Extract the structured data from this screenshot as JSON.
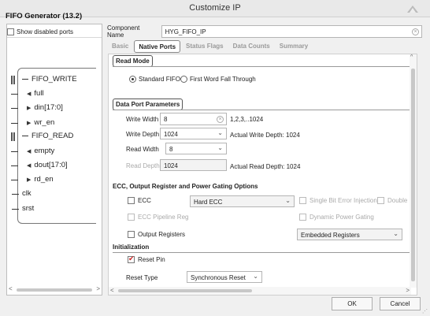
{
  "window": {
    "title": "Customize IP",
    "left_title": "FIFO Generator (13.2)"
  },
  "left": {
    "show_disabled_label": "Show disabled ports",
    "ports": [
      {
        "label": "FIFO_WRITE",
        "kind": "bus"
      },
      {
        "label": "full",
        "kind": "out"
      },
      {
        "label": "din[17:0]",
        "kind": "in"
      },
      {
        "label": "wr_en",
        "kind": "in"
      },
      {
        "label": "FIFO_READ",
        "kind": "bus"
      },
      {
        "label": "empty",
        "kind": "out"
      },
      {
        "label": "dout[17:0]",
        "kind": "out"
      },
      {
        "label": "rd_en",
        "kind": "in"
      },
      {
        "label": "clk",
        "kind": "plain"
      },
      {
        "label": "srst",
        "kind": "plain"
      }
    ]
  },
  "component": {
    "label": "Component Name",
    "value": "HYG_FIFO_IP"
  },
  "tabs": [
    {
      "label": "Basic",
      "active": false
    },
    {
      "label": "Native Ports",
      "active": true
    },
    {
      "label": "Status Flags",
      "active": false
    },
    {
      "label": "Data Counts",
      "active": false
    },
    {
      "label": "Summary",
      "active": false
    }
  ],
  "read_mode": {
    "heading": "Read Mode",
    "standard": "Standard FIFO",
    "fwft": "First Word Fall Through",
    "selected": "standard"
  },
  "data_port": {
    "heading": "Data Port Parameters",
    "write_width_label": "Write Width",
    "write_width_value": "8",
    "write_width_range": "1,2,3,..1024",
    "write_depth_label": "Write Depth",
    "write_depth_value": "1024",
    "actual_write_depth": "Actual Write Depth: 1024",
    "read_width_label": "Read Width",
    "read_width_value": "8",
    "read_depth_label": "Read Depth",
    "read_depth_value": "1024",
    "actual_read_depth": "Actual Read Depth: 1024"
  },
  "ecc": {
    "heading": "ECC, Output Register and Power Gating Options",
    "ecc_label": "ECC",
    "ecc_type": "Hard ECC",
    "single_bit": "Single Bit Error Injection",
    "double_bit": "Double Bi",
    "ecc_pipeline": "ECC Pipeline Reg",
    "dynamic_power": "Dynamic Power Gating",
    "output_registers": "Output Registers",
    "embedded_registers": "Embedded Registers"
  },
  "init": {
    "heading": "Initialization",
    "reset_pin": "Reset Pin",
    "reset_type_label": "Reset Type",
    "reset_type_value": "Synchronous Reset"
  },
  "buttons": {
    "ok": "OK",
    "cancel": "Cancel"
  },
  "colors": {
    "accent": "#c22222"
  }
}
